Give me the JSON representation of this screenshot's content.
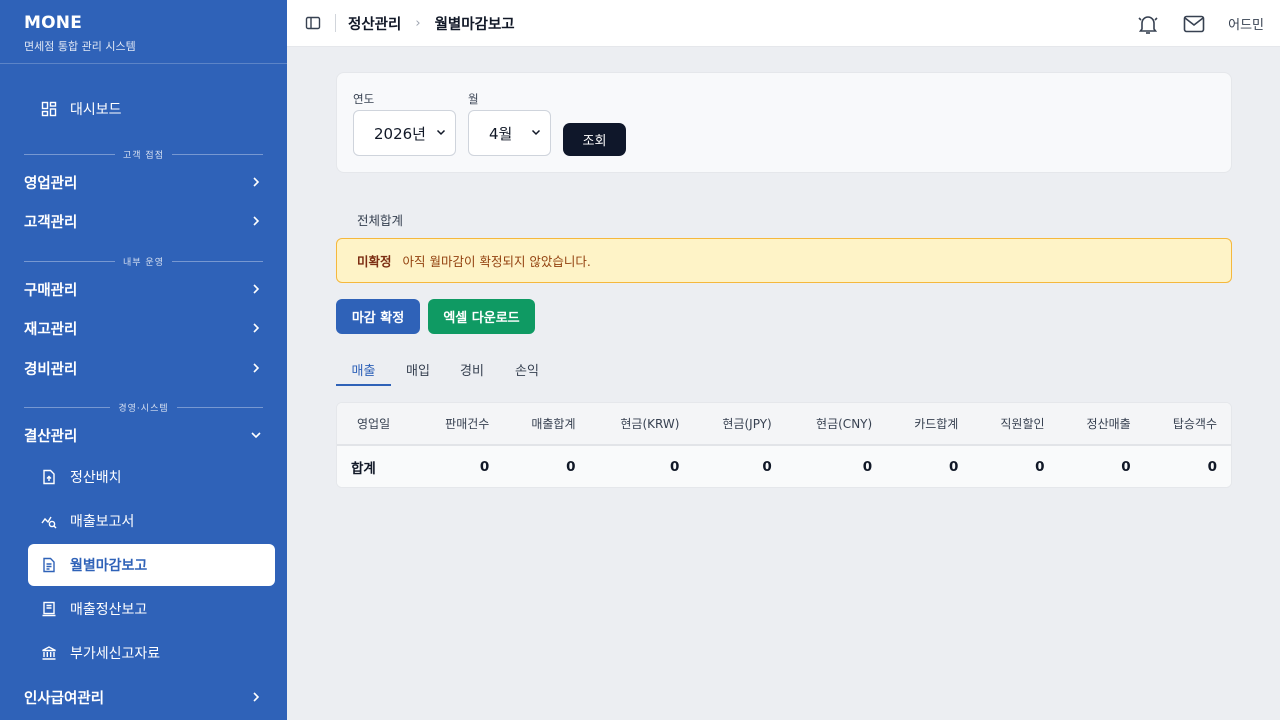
{
  "app": {
    "title": "MONE",
    "subtitle": "면세점 통합 관리 시스템"
  },
  "sidebar": {
    "dashboard": "대시보드",
    "sections": {
      "s1": "고객 접점",
      "s2": "내부 운영",
      "s3": "경영·시스템"
    },
    "groups": {
      "sales": "영업관리",
      "customer": "고객관리",
      "purchase": "구매관리",
      "inventory": "재고관리",
      "expense": "경비관리",
      "settlement": "결산관리",
      "hr": "인사급여관리"
    },
    "settlement_items": {
      "batch": "정산배치",
      "sales_report": "매출보고서",
      "monthly_close": "월별마감보고",
      "sales_settle": "매출정산보고",
      "vat": "부가세신고자료"
    }
  },
  "header": {
    "breadcrumb_parent": "정산관리",
    "breadcrumb_current": "월별마감보고",
    "user": "어드민"
  },
  "filter": {
    "year_label": "연도",
    "year_value": "2026년",
    "month_label": "월",
    "month_value": "4월",
    "search_button": "조회"
  },
  "summary_label": "전체합계",
  "alert": {
    "badge": "미확정",
    "message": "아직 월마감이 확정되지 않았습니다."
  },
  "actions": {
    "confirm": "마감 확정",
    "excel": "엑셀 다운로드"
  },
  "tabs": [
    "매출",
    "매입",
    "경비",
    "손익"
  ],
  "table": {
    "headers": [
      "영업일",
      "판매건수",
      "매출합계",
      "현금(KRW)",
      "현금(JPY)",
      "현금(CNY)",
      "카드합계",
      "직원할인",
      "정산매출",
      "탑승객수"
    ],
    "total_row": [
      "합계",
      "0",
      "0",
      "0",
      "0",
      "0",
      "0",
      "0",
      "0",
      "0"
    ]
  },
  "colors": {
    "primary": "#2f62b8",
    "excel": "#0f9a63",
    "alert_bg": "#fef3c7",
    "dark_button": "#0f172a"
  }
}
